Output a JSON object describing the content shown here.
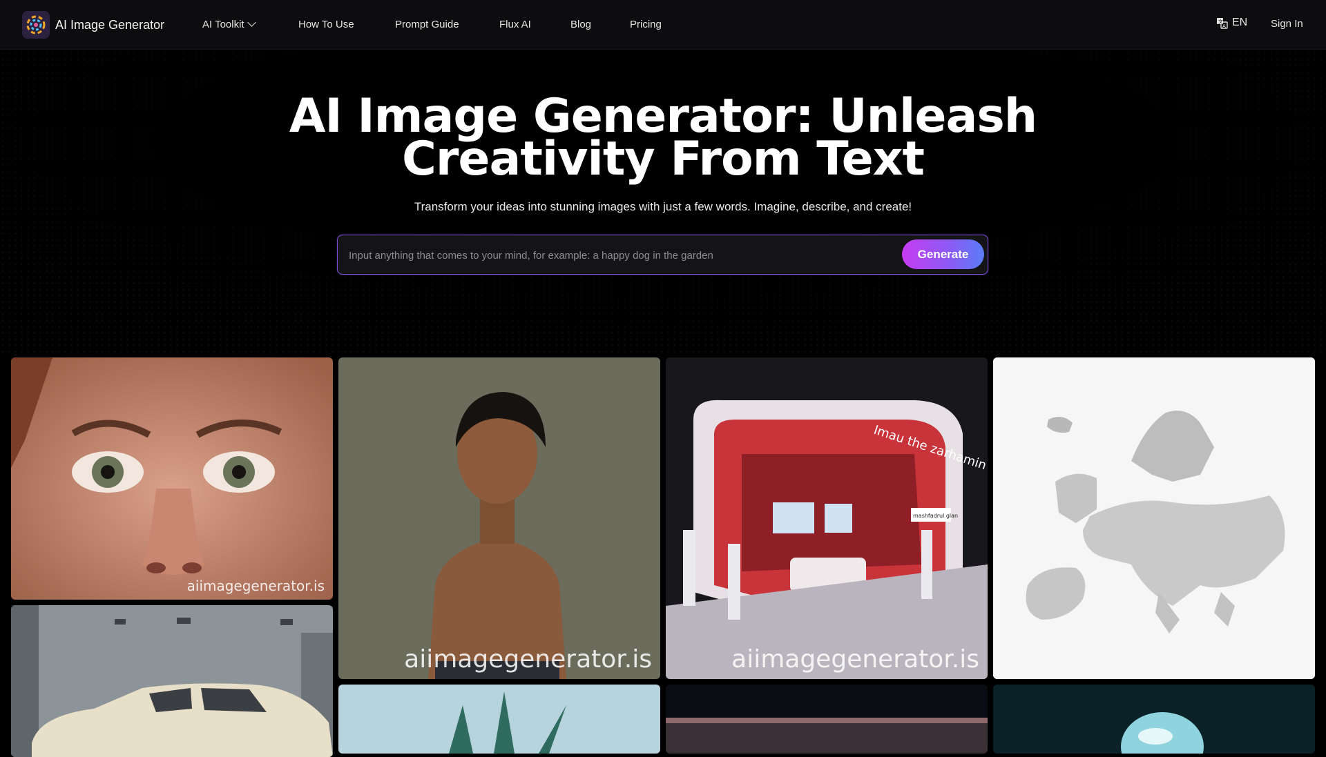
{
  "nav": {
    "brand": "AI Image Generator",
    "items": [
      {
        "label": "AI Toolkit",
        "dropdown": true
      },
      {
        "label": "How To Use"
      },
      {
        "label": "Prompt Guide"
      },
      {
        "label": "Flux AI"
      },
      {
        "label": "Blog"
      },
      {
        "label": "Pricing"
      }
    ],
    "language": "EN",
    "sign_in": "Sign In"
  },
  "hero": {
    "title": "AI Image Generator: Unleash Creativity From Text",
    "subtitle": "Transform your ideas into stunning images with just a few words. Imagine, describe, and create!",
    "input_placeholder": "Input anything that comes to your mind, for example: a happy dog in the garden",
    "generate_label": "Generate"
  },
  "gallery": {
    "watermark": "aiimagegenerator.is",
    "booth_sign": "Imau the zarhamin",
    "booth_panel": "mashfadrul glan"
  },
  "colors": {
    "accent_start": "#c63cf3",
    "accent_end": "#5a7df7",
    "background": "#000000"
  }
}
